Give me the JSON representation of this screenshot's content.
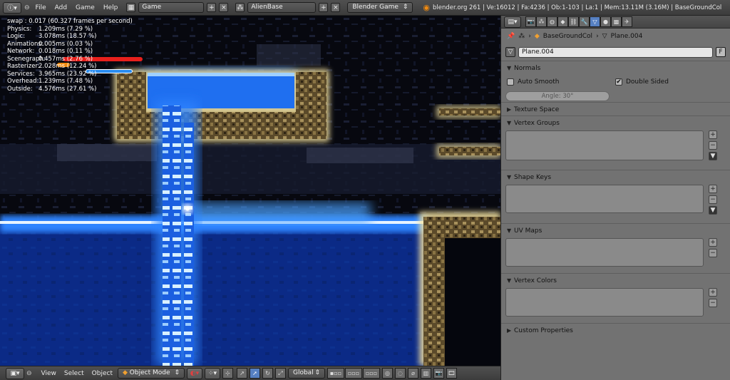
{
  "header": {
    "menu": [
      "File",
      "Add",
      "Game",
      "Help"
    ],
    "screen_name": "Game",
    "scene_name": "AlienBase",
    "render_engine": "Blender Game",
    "stats_line": "blender.org 261 | Ve:16012 | Fa:4236 | Ob:1-103 | La:1 | Mem:13.11M (3.16M) | BaseGroundCol"
  },
  "profiler": {
    "swap": "swap : 0.017 (60.327 frames per second)",
    "rows": [
      {
        "name": "Physics:",
        "value": "1.209ms (7.29 %)"
      },
      {
        "name": "Logic:",
        "value": "3.078ms (18.57 %)"
      },
      {
        "name": "Animations:",
        "value": "0.005ms (0.03 %)"
      },
      {
        "name": "Network:",
        "value": "0.018ms (0.11 %)"
      },
      {
        "name": "Scenegraph:",
        "value": "0.457ms (2.76 %)"
      },
      {
        "name": "Rasterizer:",
        "value": "2.028ms (12.24 %)"
      },
      {
        "name": "Services:",
        "value": "3.965ms (23.92 %)"
      },
      {
        "name": "Overhead:",
        "value": "1.239ms (7.48 %)"
      },
      {
        "name": "Outside:",
        "value": "4.576ms (27.61 %)"
      }
    ]
  },
  "view3d_header": {
    "menu": [
      "View",
      "Select",
      "Object"
    ],
    "mode": "Object Mode",
    "orientation": "Global"
  },
  "properties": {
    "breadcrumb": {
      "object": "BaseGroundCol",
      "mesh": "Plane.004"
    },
    "datablock_name": "Plane.004",
    "fake_user": "F",
    "panels": {
      "normals": "Normals",
      "auto_smooth": "Auto Smooth",
      "double_sided": "Double Sided",
      "angle": "Angle: 30°",
      "texture_space": "Texture Space",
      "vertex_groups": "Vertex Groups",
      "shape_keys": "Shape Keys",
      "uv_maps": "UV Maps",
      "vertex_colors": "Vertex Colors",
      "custom_properties": "Custom Properties"
    }
  },
  "colors": {
    "water": "#1f6ff0",
    "glow": "#7ab8ff",
    "ground_border": "#f5e3a0",
    "ui_active": "#5680c2",
    "bar_red": "#e8201c",
    "bar_orange": "#f08a10",
    "bar_blue": "#2a8cf0"
  }
}
